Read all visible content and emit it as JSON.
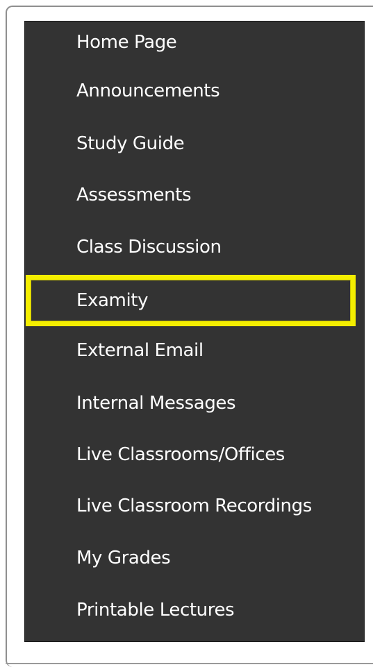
{
  "menu": {
    "items": [
      {
        "label": "Home Page",
        "highlighted": false
      },
      {
        "label": "Announcements",
        "highlighted": false
      },
      {
        "label": "Study Guide",
        "highlighted": false
      },
      {
        "label": "Assessments",
        "highlighted": false
      },
      {
        "label": "Class Discussion",
        "highlighted": false
      },
      {
        "label": "Examity",
        "highlighted": true
      },
      {
        "label": "External Email",
        "highlighted": false
      },
      {
        "label": "Internal Messages",
        "highlighted": false
      },
      {
        "label": "Live Classrooms/Offices",
        "highlighted": false
      },
      {
        "label": "Live Classroom Recordings",
        "highlighted": false
      },
      {
        "label": "My Grades",
        "highlighted": false
      },
      {
        "label": "Printable Lectures",
        "highlighted": false
      }
    ]
  },
  "colors": {
    "panel_background": "#333333",
    "text": "#ffffff",
    "highlight_border": "#f4ee00"
  }
}
